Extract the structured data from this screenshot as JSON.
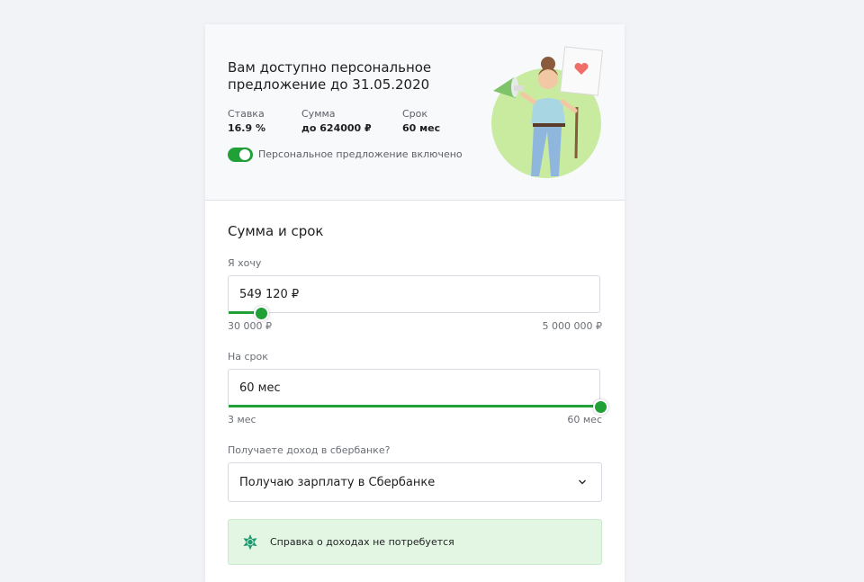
{
  "offer": {
    "title": "Вам доступно персональное предложение до 31.05.2020",
    "stats": [
      {
        "label": "Ставка",
        "value": "16.9 %"
      },
      {
        "label": "Сумма",
        "value": "до 624000 ₽"
      },
      {
        "label": "Срок",
        "value": "60 мес"
      }
    ],
    "toggle": {
      "label": "Персональное предложение включено",
      "on": true
    }
  },
  "form": {
    "section_title": "Сумма и срок",
    "amount": {
      "label": "Я хочу",
      "value": "549 120 ₽",
      "min_label": "30 000 ₽",
      "max_label": "5 000 000 ₽",
      "level": 0.09
    },
    "term": {
      "label": "На срок",
      "value": "60 мес",
      "min_label": "3 мес",
      "max_label": "60 мес",
      "level": 1.0
    },
    "income": {
      "label": "Получаете доход в сбербанке?",
      "selected": "Получаю зарплату в Сбербанке"
    },
    "notice": {
      "text": "Справка о доходах не потребуется"
    }
  },
  "colors": {
    "accent": "#21a038",
    "notice_bg": "#e2f6e3",
    "illustration_circle": "#c9eba0"
  },
  "icons": [
    "chevron-down-icon",
    "badge-star-icon",
    "promo-illustration"
  ]
}
